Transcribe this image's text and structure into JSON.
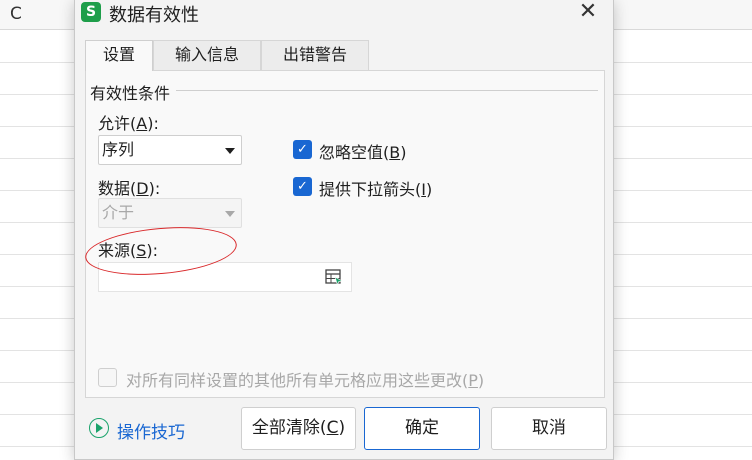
{
  "sheet": {
    "column_label": "C"
  },
  "dialog": {
    "app_icon_letter": "S",
    "title": "数据有效性",
    "close_glyph": "✕"
  },
  "tabs": [
    {
      "label": "设置",
      "active": true
    },
    {
      "label": "输入信息",
      "active": false
    },
    {
      "label": "出错警告",
      "active": false
    }
  ],
  "settings": {
    "group_title": "有效性条件",
    "allow": {
      "label": "允许",
      "accel": "A",
      "value": "序列"
    },
    "data": {
      "label": "数据",
      "accel": "D",
      "value": "介于",
      "disabled": true
    },
    "ignore_blank": {
      "label": "忽略空值",
      "accel": "B",
      "checked": true
    },
    "dropdown_arrow": {
      "label": "提供下拉箭头",
      "accel": "I",
      "checked": true
    },
    "source": {
      "label": "来源",
      "accel": "S",
      "value": ""
    },
    "apply_all": {
      "label": "对所有同样设置的其他所有单元格应用这些更改",
      "accel": "P",
      "checked": false,
      "disabled": true
    },
    "highlight_color": "#d9282a"
  },
  "footer": {
    "tips_label": "操作技巧",
    "clear_all": {
      "label": "全部清除",
      "accel": "C"
    },
    "ok_label": "确定",
    "cancel_label": "取消"
  },
  "colors": {
    "accent": "#1967d2",
    "app_icon": "#1e9e4a",
    "tips_icon": "#1aa36b"
  }
}
